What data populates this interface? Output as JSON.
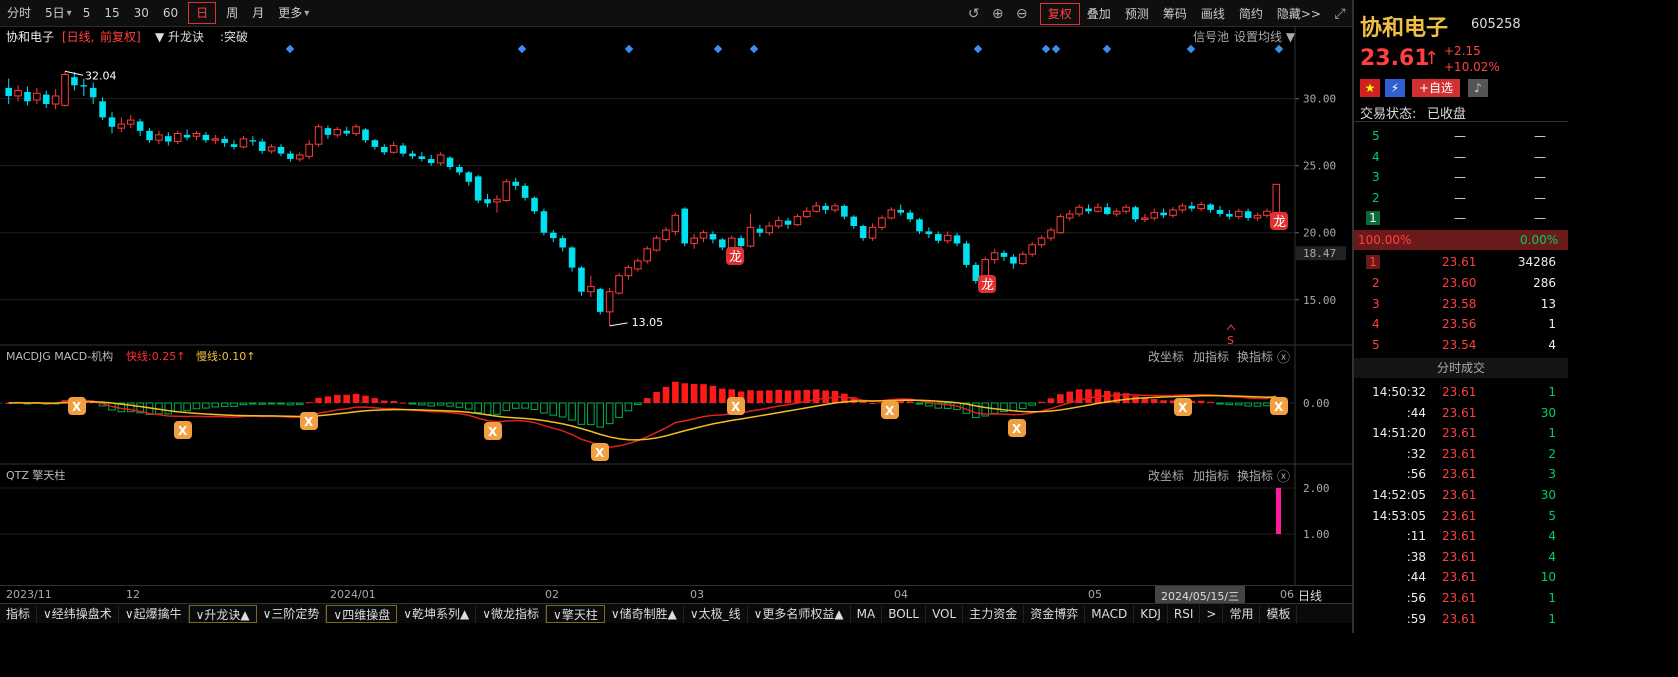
{
  "toolbar": {
    "left": [
      "分时",
      "5日",
      "5",
      "15",
      "30",
      "60",
      "日",
      "周",
      "月",
      "更多"
    ],
    "active": "日",
    "right": [
      "复权",
      "叠加",
      "预测",
      "筹码",
      "画线",
      "简约",
      "隐藏>>"
    ]
  },
  "stock": {
    "name": "协和电子",
    "code": "605258",
    "price": "23.61",
    "arrow": "↑",
    "change": "+2.15",
    "pct": "+10.02%",
    "status_label": "交易状态:",
    "status": "已收盘",
    "add_watch": "+自选"
  },
  "main_chart": {
    "info": {
      "name": "协和电子",
      "period": "[日线,",
      "fq": "前复权]",
      "indicator": "升龙诀",
      "signal": ":突破"
    },
    "right_links": [
      "信号池",
      "设置均线"
    ],
    "y_ticks": [
      "30.00",
      "25.00",
      "20.00",
      "15.00"
    ],
    "current_price_tag": "18.47",
    "high_label": "32.04",
    "low_label": "13.05",
    "dragon_label": "龙",
    "s_label": "S"
  },
  "macd": {
    "title": "MACDJG MACD-机构",
    "fast": "快线:0.25↑",
    "slow": "慢线:0.10↑",
    "tick": "0.00"
  },
  "qtz": {
    "title": "QTZ 擎天柱",
    "ticks": [
      "2.00",
      "1.00"
    ]
  },
  "panel_links": [
    "改坐标",
    "加指标",
    "换指标"
  ],
  "date_axis": {
    "labels": [
      "2023/11",
      "12",
      "2024/01",
      "02",
      "03",
      "04",
      "05",
      "06"
    ],
    "cursor_date": "2024/05/15/三",
    "period_label": "日线"
  },
  "bottom_tabs": [
    "指标",
    "∨经纬操盘术",
    "∨起爆擒牛",
    "∨升龙诀▲",
    "∨三阶定势",
    "∨四维操盘",
    "∨乾坤系列▲",
    "∨微龙指标",
    "∨擎天柱",
    "∨储奇制胜▲",
    "∨太极_线",
    "∨更多名师权益▲",
    "MA",
    "BOLL",
    "VOL",
    "主力资金",
    "资金博弈",
    "MACD",
    "KDJ",
    "RSI",
    ">",
    "常用",
    "模板"
  ],
  "order_book": {
    "asks": [
      {
        "level": "5",
        "price": "—",
        "vol": "—"
      },
      {
        "level": "4",
        "price": "—",
        "vol": "—"
      },
      {
        "level": "3",
        "price": "—",
        "vol": "—"
      },
      {
        "level": "2",
        "price": "—",
        "vol": "—"
      },
      {
        "level": "1",
        "price": "—",
        "vol": "—"
      }
    ],
    "ratio_left": "100.00%",
    "ratio_right": "0.00%",
    "bids": [
      {
        "level": "1",
        "price": "23.61",
        "vol": "34286"
      },
      {
        "level": "2",
        "price": "23.60",
        "vol": "286"
      },
      {
        "level": "3",
        "price": "23.58",
        "vol": "13"
      },
      {
        "level": "4",
        "price": "23.56",
        "vol": "1"
      },
      {
        "level": "5",
        "price": "23.54",
        "vol": "4"
      }
    ]
  },
  "trades_title": "分时成交",
  "trades": [
    {
      "time": "14:50:32",
      "price": "23.61",
      "vol": "1"
    },
    {
      "time": ":44",
      "price": "23.61",
      "vol": "30"
    },
    {
      "time": "14:51:20",
      "price": "23.61",
      "vol": "1"
    },
    {
      "time": ":32",
      "price": "23.61",
      "vol": "2"
    },
    {
      "time": ":56",
      "price": "23.61",
      "vol": "3"
    },
    {
      "time": "14:52:05",
      "price": "23.61",
      "vol": "30"
    },
    {
      "time": "14:53:05",
      "price": "23.61",
      "vol": "5"
    },
    {
      "time": ":11",
      "price": "23.61",
      "vol": "4"
    },
    {
      "time": ":38",
      "price": "23.61",
      "vol": "4"
    },
    {
      "time": ":44",
      "price": "23.61",
      "vol": "10"
    },
    {
      "time": ":56",
      "price": "23.61",
      "vol": "1"
    },
    {
      "time": ":59",
      "price": "23.61",
      "vol": "1"
    }
  ],
  "chart_data": {
    "type": "candlestick",
    "title": "协和电子 日线 前复权",
    "ylim": [
      12,
      34
    ],
    "candles": [
      {
        "o": 30.8,
        "c": 30.2,
        "h": 31.5,
        "l": 29.6
      },
      {
        "o": 30.2,
        "c": 30.6,
        "h": 31.0,
        "l": 29.8
      },
      {
        "o": 30.5,
        "c": 29.8,
        "h": 30.9,
        "l": 29.5
      },
      {
        "o": 29.9,
        "c": 30.4,
        "h": 30.8,
        "l": 29.6
      },
      {
        "o": 30.3,
        "c": 29.6,
        "h": 30.6,
        "l": 29.3
      },
      {
        "o": 29.6,
        "c": 30.2,
        "h": 30.7,
        "l": 29.2
      },
      {
        "o": 29.5,
        "c": 31.8,
        "h": 32.04,
        "l": 29.4
      },
      {
        "o": 31.6,
        "c": 31.0,
        "h": 32.0,
        "l": 30.6
      },
      {
        "o": 31.0,
        "c": 30.9,
        "h": 31.5,
        "l": 30.2
      },
      {
        "o": 30.8,
        "c": 30.1,
        "h": 31.2,
        "l": 29.6
      },
      {
        "o": 29.8,
        "c": 28.6,
        "h": 30.1,
        "l": 28.4
      },
      {
        "o": 28.6,
        "c": 27.9,
        "h": 29.0,
        "l": 27.4
      },
      {
        "o": 27.8,
        "c": 28.1,
        "h": 28.6,
        "l": 27.5
      },
      {
        "o": 28.1,
        "c": 28.4,
        "h": 28.8,
        "l": 27.8
      },
      {
        "o": 28.3,
        "c": 27.6,
        "h": 28.5,
        "l": 27.2
      },
      {
        "o": 27.6,
        "c": 26.9,
        "h": 27.8,
        "l": 26.7
      },
      {
        "o": 26.9,
        "c": 27.3,
        "h": 27.6,
        "l": 26.6
      },
      {
        "o": 27.2,
        "c": 26.8,
        "h": 27.5,
        "l": 26.5
      },
      {
        "o": 26.8,
        "c": 27.4,
        "h": 27.6,
        "l": 26.6
      },
      {
        "o": 27.3,
        "c": 27.1,
        "h": 27.7,
        "l": 26.9
      },
      {
        "o": 27.2,
        "c": 27.4,
        "h": 27.6,
        "l": 26.9
      },
      {
        "o": 27.3,
        "c": 26.9,
        "h": 27.5,
        "l": 26.7
      },
      {
        "o": 26.9,
        "c": 27.0,
        "h": 27.3,
        "l": 26.6
      },
      {
        "o": 27.0,
        "c": 26.7,
        "h": 27.2,
        "l": 26.4
      },
      {
        "o": 26.6,
        "c": 26.4,
        "h": 26.9,
        "l": 26.2
      },
      {
        "o": 26.4,
        "c": 27.0,
        "h": 27.2,
        "l": 26.3
      },
      {
        "o": 26.9,
        "c": 26.8,
        "h": 27.2,
        "l": 26.5
      },
      {
        "o": 26.8,
        "c": 26.1,
        "h": 27.0,
        "l": 25.9
      },
      {
        "o": 26.1,
        "c": 26.4,
        "h": 26.6,
        "l": 25.9
      },
      {
        "o": 26.4,
        "c": 25.9,
        "h": 26.6,
        "l": 25.7
      },
      {
        "o": 25.9,
        "c": 25.5,
        "h": 26.1,
        "l": 25.3
      },
      {
        "o": 25.5,
        "c": 25.8,
        "h": 26.0,
        "l": 25.3
      },
      {
        "o": 25.7,
        "c": 26.6,
        "h": 26.9,
        "l": 25.5
      },
      {
        "o": 26.6,
        "c": 27.9,
        "h": 28.1,
        "l": 26.4
      },
      {
        "o": 27.8,
        "c": 27.3,
        "h": 28.0,
        "l": 27.0
      },
      {
        "o": 27.3,
        "c": 27.7,
        "h": 27.9,
        "l": 27.1
      },
      {
        "o": 27.6,
        "c": 27.4,
        "h": 27.9,
        "l": 27.2
      },
      {
        "o": 27.4,
        "c": 27.9,
        "h": 28.1,
        "l": 27.2
      },
      {
        "o": 27.7,
        "c": 26.9,
        "h": 27.8,
        "l": 26.7
      },
      {
        "o": 26.9,
        "c": 26.4,
        "h": 27.0,
        "l": 26.2
      },
      {
        "o": 26.4,
        "c": 26.0,
        "h": 26.6,
        "l": 25.8
      },
      {
        "o": 26.0,
        "c": 26.5,
        "h": 26.8,
        "l": 25.9
      },
      {
        "o": 26.5,
        "c": 25.9,
        "h": 26.7,
        "l": 25.7
      },
      {
        "o": 25.9,
        "c": 25.7,
        "h": 26.1,
        "l": 25.5
      },
      {
        "o": 25.7,
        "c": 25.5,
        "h": 26.0,
        "l": 25.3
      },
      {
        "o": 25.5,
        "c": 25.2,
        "h": 25.8,
        "l": 25.0
      },
      {
        "o": 25.2,
        "c": 25.8,
        "h": 26.0,
        "l": 25.0
      },
      {
        "o": 25.6,
        "c": 24.9,
        "h": 25.7,
        "l": 24.7
      },
      {
        "o": 24.9,
        "c": 24.5,
        "h": 25.1,
        "l": 24.3
      },
      {
        "o": 24.5,
        "c": 23.8,
        "h": 24.6,
        "l": 23.5
      },
      {
        "o": 24.2,
        "c": 22.4,
        "h": 24.3,
        "l": 22.2
      },
      {
        "o": 22.5,
        "c": 22.2,
        "h": 22.9,
        "l": 21.9
      },
      {
        "o": 22.3,
        "c": 22.5,
        "h": 22.8,
        "l": 21.5
      },
      {
        "o": 22.4,
        "c": 23.8,
        "h": 24.0,
        "l": 22.3
      },
      {
        "o": 23.8,
        "c": 23.5,
        "h": 24.1,
        "l": 23.2
      },
      {
        "o": 23.5,
        "c": 22.6,
        "h": 23.7,
        "l": 22.4
      },
      {
        "o": 22.6,
        "c": 21.6,
        "h": 22.7,
        "l": 21.4
      },
      {
        "o": 21.6,
        "c": 20.0,
        "h": 21.8,
        "l": 19.8
      },
      {
        "o": 20.0,
        "c": 19.6,
        "h": 20.2,
        "l": 19.3
      },
      {
        "o": 19.6,
        "c": 18.9,
        "h": 19.8,
        "l": 18.6
      },
      {
        "o": 18.9,
        "c": 17.4,
        "h": 19.0,
        "l": 17.1
      },
      {
        "o": 17.4,
        "c": 15.6,
        "h": 17.5,
        "l": 15.3
      },
      {
        "o": 15.6,
        "c": 16.0,
        "h": 16.8,
        "l": 15.2
      },
      {
        "o": 15.8,
        "c": 14.1,
        "h": 15.9,
        "l": 13.9
      },
      {
        "o": 14.1,
        "c": 15.6,
        "h": 15.9,
        "l": 13.05
      },
      {
        "o": 15.5,
        "c": 16.8,
        "h": 17.0,
        "l": 15.4
      },
      {
        "o": 16.8,
        "c": 17.4,
        "h": 17.6,
        "l": 16.5
      },
      {
        "o": 17.3,
        "c": 17.9,
        "h": 18.1,
        "l": 17.1
      },
      {
        "o": 17.9,
        "c": 18.8,
        "h": 19.0,
        "l": 17.7
      },
      {
        "o": 18.7,
        "c": 19.6,
        "h": 19.8,
        "l": 18.6
      },
      {
        "o": 19.5,
        "c": 20.2,
        "h": 20.4,
        "l": 19.3
      },
      {
        "o": 20.1,
        "c": 21.3,
        "h": 21.5,
        "l": 19.8
      },
      {
        "o": 21.8,
        "c": 19.2,
        "h": 21.9,
        "l": 19.0
      },
      {
        "o": 19.2,
        "c": 19.6,
        "h": 19.9,
        "l": 18.8
      },
      {
        "o": 19.6,
        "c": 20.0,
        "h": 20.2,
        "l": 19.3
      },
      {
        "o": 19.9,
        "c": 19.5,
        "h": 20.1,
        "l": 19.2
      },
      {
        "o": 19.5,
        "c": 18.9,
        "h": 19.6,
        "l": 18.7
      },
      {
        "o": 18.9,
        "c": 19.6,
        "h": 19.8,
        "l": 18.7
      },
      {
        "o": 19.6,
        "c": 19.0,
        "h": 19.8,
        "l": 18.8
      },
      {
        "o": 19.0,
        "c": 20.4,
        "h": 21.4,
        "l": 18.9
      },
      {
        "o": 20.3,
        "c": 20.0,
        "h": 20.6,
        "l": 19.7
      },
      {
        "o": 20.0,
        "c": 20.5,
        "h": 20.8,
        "l": 19.8
      },
      {
        "o": 20.5,
        "c": 20.9,
        "h": 21.2,
        "l": 20.3
      },
      {
        "o": 20.9,
        "c": 20.6,
        "h": 21.1,
        "l": 20.3
      },
      {
        "o": 20.6,
        "c": 21.2,
        "h": 21.4,
        "l": 20.5
      },
      {
        "o": 21.2,
        "c": 21.6,
        "h": 21.9,
        "l": 21.1
      },
      {
        "o": 21.6,
        "c": 22.0,
        "h": 22.3,
        "l": 21.5
      },
      {
        "o": 22.0,
        "c": 21.7,
        "h": 22.2,
        "l": 21.4
      },
      {
        "o": 21.7,
        "c": 22.0,
        "h": 22.2,
        "l": 21.5
      },
      {
        "o": 22.0,
        "c": 21.2,
        "h": 22.1,
        "l": 21.0
      },
      {
        "o": 21.2,
        "c": 20.5,
        "h": 21.3,
        "l": 20.3
      },
      {
        "o": 20.5,
        "c": 19.6,
        "h": 20.6,
        "l": 19.4
      },
      {
        "o": 19.6,
        "c": 20.4,
        "h": 20.7,
        "l": 19.4
      },
      {
        "o": 20.4,
        "c": 21.1,
        "h": 21.3,
        "l": 20.2
      },
      {
        "o": 21.1,
        "c": 21.7,
        "h": 21.9,
        "l": 21.0
      },
      {
        "o": 21.7,
        "c": 21.5,
        "h": 22.1,
        "l": 21.3
      },
      {
        "o": 21.5,
        "c": 21.0,
        "h": 21.7,
        "l": 20.8
      },
      {
        "o": 21.0,
        "c": 20.1,
        "h": 21.1,
        "l": 19.9
      },
      {
        "o": 20.1,
        "c": 19.9,
        "h": 20.4,
        "l": 19.6
      },
      {
        "o": 19.9,
        "c": 19.4,
        "h": 20.1,
        "l": 19.2
      },
      {
        "o": 19.4,
        "c": 19.8,
        "h": 20.1,
        "l": 19.2
      },
      {
        "o": 19.8,
        "c": 19.2,
        "h": 20.0,
        "l": 19.0
      },
      {
        "o": 19.2,
        "c": 17.6,
        "h": 19.4,
        "l": 17.4
      },
      {
        "o": 17.6,
        "c": 16.4,
        "h": 17.8,
        "l": 16.2
      },
      {
        "o": 16.6,
        "c": 18.0,
        "h": 18.2,
        "l": 16.5
      },
      {
        "o": 18.0,
        "c": 18.5,
        "h": 18.8,
        "l": 17.7
      },
      {
        "o": 18.5,
        "c": 18.2,
        "h": 18.7,
        "l": 17.9
      },
      {
        "o": 18.2,
        "c": 17.7,
        "h": 18.4,
        "l": 17.3
      },
      {
        "o": 17.7,
        "c": 18.4,
        "h": 18.6,
        "l": 17.6
      },
      {
        "o": 18.4,
        "c": 19.1,
        "h": 19.3,
        "l": 18.2
      },
      {
        "o": 19.1,
        "c": 19.6,
        "h": 19.8,
        "l": 18.9
      },
      {
        "o": 19.6,
        "c": 20.2,
        "h": 20.4,
        "l": 19.4
      },
      {
        "o": 20.0,
        "c": 21.2,
        "h": 21.4,
        "l": 19.9
      },
      {
        "o": 21.1,
        "c": 21.4,
        "h": 21.7,
        "l": 20.9
      },
      {
        "o": 21.4,
        "c": 21.9,
        "h": 22.1,
        "l": 21.2
      },
      {
        "o": 21.8,
        "c": 21.6,
        "h": 22.1,
        "l": 21.4
      },
      {
        "o": 21.6,
        "c": 21.9,
        "h": 22.2,
        "l": 21.5
      },
      {
        "o": 21.9,
        "c": 21.4,
        "h": 22.2,
        "l": 21.3
      },
      {
        "o": 21.4,
        "c": 21.6,
        "h": 21.8,
        "l": 21.2
      },
      {
        "o": 21.6,
        "c": 21.9,
        "h": 22.1,
        "l": 21.4
      },
      {
        "o": 21.9,
        "c": 21.0,
        "h": 22.0,
        "l": 20.8
      },
      {
        "o": 21.0,
        "c": 21.1,
        "h": 21.4,
        "l": 20.8
      },
      {
        "o": 21.1,
        "c": 21.5,
        "h": 21.8,
        "l": 20.9
      },
      {
        "o": 21.5,
        "c": 21.3,
        "h": 21.8,
        "l": 21.1
      },
      {
        "o": 21.3,
        "c": 21.7,
        "h": 21.9,
        "l": 21.1
      },
      {
        "o": 21.7,
        "c": 22.0,
        "h": 22.2,
        "l": 21.5
      },
      {
        "o": 22.0,
        "c": 21.8,
        "h": 22.3,
        "l": 21.6
      },
      {
        "o": 21.8,
        "c": 22.1,
        "h": 22.3,
        "l": 21.6
      },
      {
        "o": 22.1,
        "c": 21.7,
        "h": 22.2,
        "l": 21.5
      },
      {
        "o": 21.7,
        "c": 21.4,
        "h": 22.0,
        "l": 21.2
      },
      {
        "o": 21.4,
        "c": 21.2,
        "h": 21.7,
        "l": 21.0
      },
      {
        "o": 21.2,
        "c": 21.6,
        "h": 21.8,
        "l": 21.0
      },
      {
        "o": 21.6,
        "c": 21.1,
        "h": 21.8,
        "l": 20.9
      },
      {
        "o": 21.1,
        "c": 21.3,
        "h": 21.5,
        "l": 20.9
      },
      {
        "o": 21.3,
        "c": 21.6,
        "h": 21.8,
        "l": 21.1
      },
      {
        "o": 21.5,
        "c": 23.61,
        "h": 23.61,
        "l": 21.4
      }
    ]
  }
}
